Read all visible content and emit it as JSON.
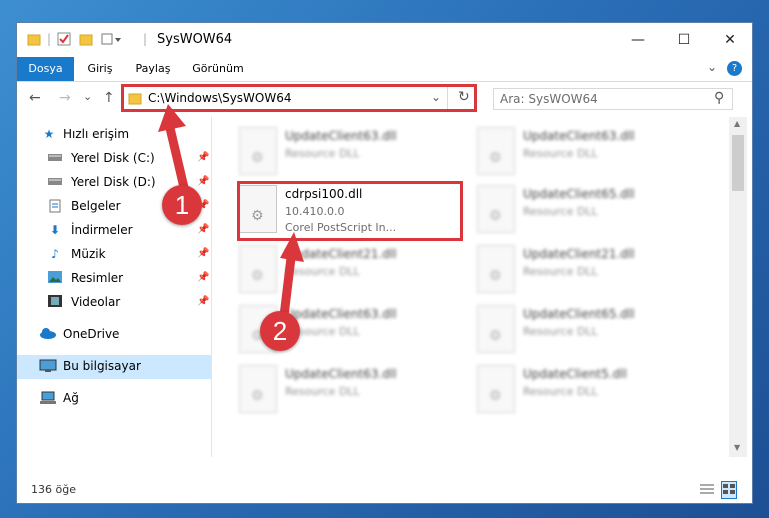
{
  "window": {
    "title": "SysWOW64",
    "minimize_glyph": "—",
    "maximize_glyph": "☐",
    "close_glyph": "✕"
  },
  "ribbon": {
    "tabs": [
      {
        "label": "Dosya",
        "active": true
      },
      {
        "label": "Giriş"
      },
      {
        "label": "Paylaş"
      },
      {
        "label": "Görünüm"
      }
    ],
    "collapse_glyph": "⌄",
    "help_glyph": "?"
  },
  "navigation": {
    "back_glyph": "←",
    "forward_glyph": "→",
    "recent_glyph": "⌄",
    "up_glyph": "↑",
    "address": "C:\\Windows\\SysWOW64",
    "dropdown_glyph": "⌄",
    "refresh_glyph": "↻",
    "search_placeholder": "Ara: SysWOW64",
    "search_glyph": "⚲"
  },
  "sidebar": {
    "items": [
      {
        "label": "Hızlı erişim",
        "icon": "star-icon"
      },
      {
        "label": "Yerel Disk (C:)",
        "icon": "drive-icon",
        "pinned": true
      },
      {
        "label": "Yerel Disk (D:)",
        "icon": "drive-icon",
        "pinned": true
      },
      {
        "label": "Belgeler",
        "icon": "document-icon",
        "pinned": true
      },
      {
        "label": "İndirmeler",
        "icon": "download-icon",
        "pinned": true
      },
      {
        "label": "Müzik",
        "icon": "music-icon",
        "pinned": true
      },
      {
        "label": "Resimler",
        "icon": "pictures-icon",
        "pinned": true
      },
      {
        "label": "Videolar",
        "icon": "video-icon",
        "pinned": true
      },
      {
        "label": "OneDrive",
        "icon": "cloud-icon"
      },
      {
        "label": "Bu bilgisayar",
        "icon": "computer-icon",
        "selected": true
      },
      {
        "label": "Ağ",
        "icon": "network-icon"
      }
    ]
  },
  "files": {
    "left": [
      {
        "name": "UpdateClient63.dll",
        "type": "Resource DLL"
      },
      {
        "name": "cdrpsi100.dll",
        "version": "10.410.0.0",
        "description": "Corel PostScript In...",
        "highlighted": true
      },
      {
        "name": "UpdateClient21.dll",
        "type": "Resource DLL"
      },
      {
        "name": "UpdateClient63.dll",
        "type": "Resource DLL"
      },
      {
        "name": "UpdateClient63.dll",
        "type": "Resource DLL"
      }
    ],
    "right": [
      {
        "name": "UpdateClient63.dll",
        "type": "Resource DLL"
      },
      {
        "name": "UpdateClient65.dll",
        "type": "Resource DLL"
      },
      {
        "name": "UpdateClient21.dll",
        "type": "Resource DLL"
      },
      {
        "name": "UpdateClient65.dll",
        "type": "Resource DLL"
      },
      {
        "name": "UpdateClient5.dll",
        "type": "Resource DLL"
      }
    ]
  },
  "status": {
    "item_count": "136 öğe"
  },
  "annotations": {
    "marker1": "1",
    "marker2": "2",
    "color": "#d9373b"
  },
  "colors": {
    "accent": "#1979ca",
    "highlight": "#d9373b"
  }
}
